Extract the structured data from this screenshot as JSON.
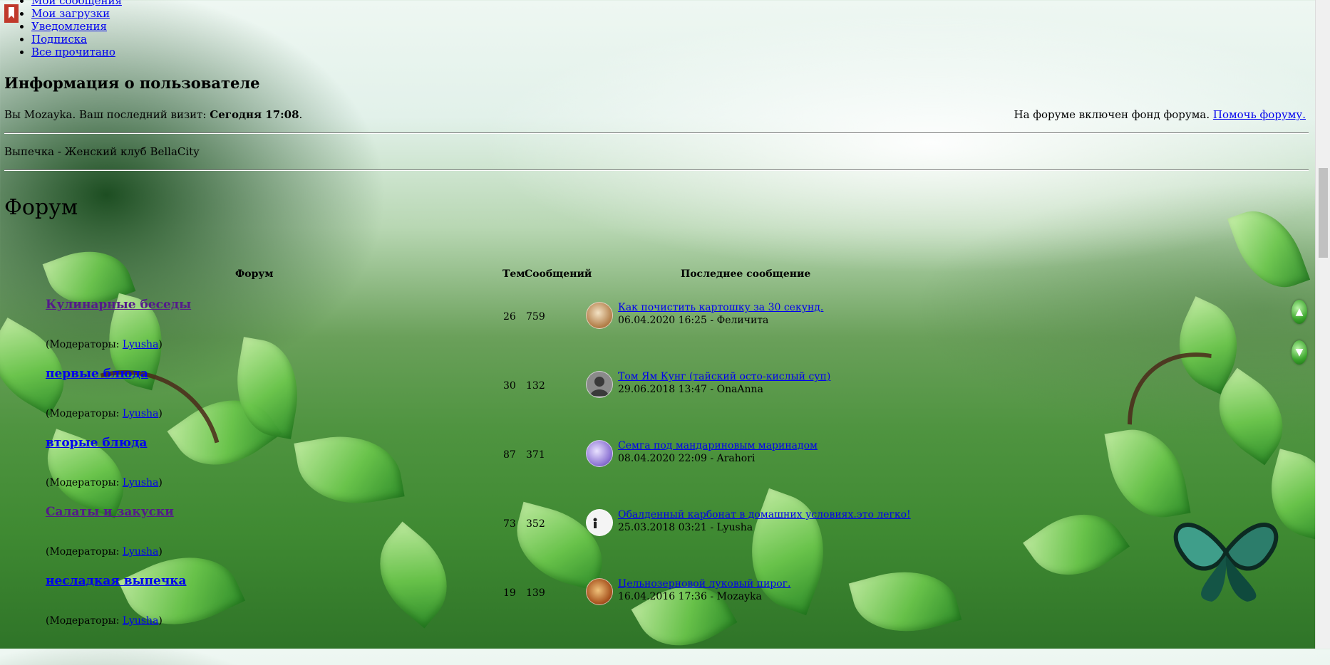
{
  "top_menu": {
    "items": [
      "Мои сообщения",
      "Мои загрузки",
      "Уведомления",
      "Подписка",
      "Все прочитано"
    ]
  },
  "user_info": {
    "title": "Информация о пользователе",
    "greeting_prefix": "Вы",
    "username": "Mozayka",
    "visit_label": ". Ваш последний визит: ",
    "visit_value": "Сегодня 17:08",
    "visit_suffix": ".",
    "fund_text": "На форуме включен фонд форума. ",
    "fund_link": "Помочь форуму."
  },
  "breadcrumb": "Выпечка - Женский клуб BellaCity",
  "forum": {
    "title": "Форум",
    "headers": {
      "forum": "Форум",
      "topics": "Тем",
      "posts": "Сообщений",
      "last_post": "Последнее сообщение"
    },
    "moderators_prefix": "(Модераторы: ",
    "moderators_suffix": ")",
    "rows": [
      {
        "name": "Кулинарные беседы",
        "moderator": "Lyusha",
        "topics": "26",
        "posts": "759",
        "last_title": "Как почистить картошку за 30 секунд.",
        "last_meta": "06.04.2020 16:25 - Феличита",
        "avatar_color": "#c9a27a"
      },
      {
        "name": "первые блюда",
        "moderator": "Lyusha",
        "topics": "30",
        "posts": "132",
        "last_title": "Том Ям Кунг (тайский осто-кислый суп)",
        "last_meta": "29.06.2018 13:47 - OnaAnna",
        "avatar_color": "#8a8a8a"
      },
      {
        "name": "вторые блюда",
        "moderator": "Lyusha",
        "topics": "87",
        "posts": "371",
        "last_title": "Семга под мандариновым маринадом",
        "last_meta": "08.04.2020 22:09 - Arahori",
        "avatar_color": "#9a86d6"
      },
      {
        "name": "Салаты и закуски",
        "moderator": "Lyusha",
        "topics": "73",
        "posts": "352",
        "last_title": "Обалденный карбонат в домашних условиях.это легко!",
        "last_meta": "25.03.2018 03:21 - Lyusha",
        "avatar_color": "#f4f4f4"
      },
      {
        "name": "несладкая выпечка",
        "moderator": "Lyusha",
        "topics": "19",
        "posts": "139",
        "last_title": "Цельнозерновой луковый пирог.",
        "last_meta": "16.04.2016 17:36 - Mozayka",
        "avatar_color": "#b0652d"
      }
    ]
  },
  "scroll": {
    "up_glyph": "▲",
    "down_glyph": "▼"
  }
}
